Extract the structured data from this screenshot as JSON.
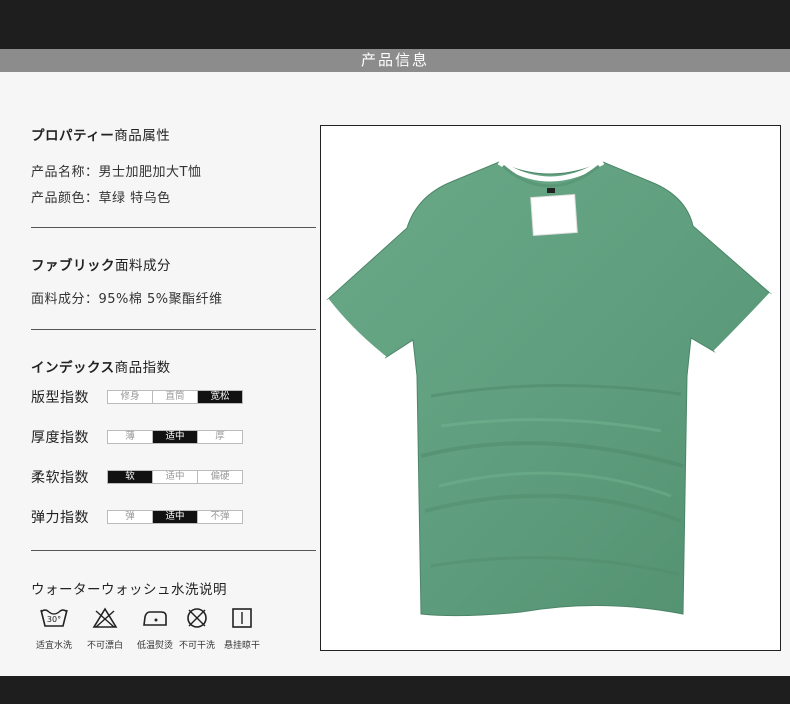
{
  "header": {
    "title": "产品信息"
  },
  "property": {
    "title_jp": "プロパティー",
    "title_cn": "商品属性",
    "name_line": "产品名称：男士加肥加大T恤",
    "color_line": "产品颜色：草绿 特乌色"
  },
  "fabric": {
    "title_jp": "ファブリック",
    "title_cn": "面料成分",
    "composition_line": "面料成分：95%棉 5%聚酯纤维"
  },
  "index": {
    "title_jp": "インデックス",
    "title_cn": "商品指数",
    "rows": [
      {
        "label": "版型指数",
        "options": [
          "修身",
          "直筒",
          "宽松"
        ],
        "selected": 2
      },
      {
        "label": "厚度指数",
        "options": [
          "薄",
          "适中",
          "厚"
        ],
        "selected": 1
      },
      {
        "label": "柔软指数",
        "options": [
          "软",
          "适中",
          "偏硬"
        ],
        "selected": 0
      },
      {
        "label": "弹力指数",
        "options": [
          "弹",
          "适中",
          "不弹"
        ],
        "selected": 1
      }
    ]
  },
  "washing": {
    "title_jp": "ウォーターウォッシュ",
    "title_cn": "水洗说明",
    "icons": [
      {
        "icon": "wash-30-icon",
        "label": "适宜水洗",
        "mark": "30°"
      },
      {
        "icon": "no-bleach-icon",
        "label": "不可漂白"
      },
      {
        "icon": "low-temp-iron-icon",
        "label": "低温熨烫"
      },
      {
        "icon": "no-dry-clean-icon",
        "label": "不可干洗"
      },
      {
        "icon": "hang-dry-icon",
        "label": "悬挂晾干"
      }
    ]
  },
  "product_image": {
    "description": "green t-shirt",
    "shirt_color": "#5f9f7f",
    "trim_color": "#ffffff"
  }
}
